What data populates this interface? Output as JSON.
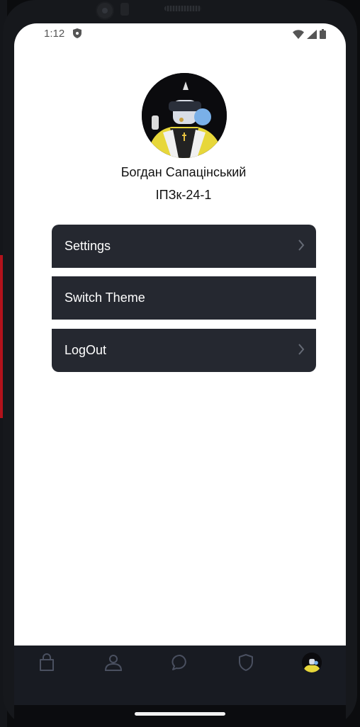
{
  "status_bar": {
    "time": "1:12",
    "icons": [
      "shield-icon",
      "wifi-icon",
      "signal-icon",
      "battery-icon"
    ]
  },
  "profile": {
    "name": "Богдан Сапацінський",
    "group": "ІПЗк-24-1",
    "avatar": "avatar-illustration"
  },
  "menu": {
    "settings_label": "Settings",
    "switch_theme_label": "Switch Theme",
    "logout_label": "LogOut"
  },
  "bottom_nav": {
    "items": [
      "bag-icon",
      "person-icon",
      "chat-icon",
      "shield-icon",
      "profile-avatar"
    ],
    "background": "#181b22",
    "icon_color": "#4a5060"
  },
  "colors": {
    "menu_background": "#252830",
    "screen_background": "#ffffff",
    "text": "#111111"
  }
}
